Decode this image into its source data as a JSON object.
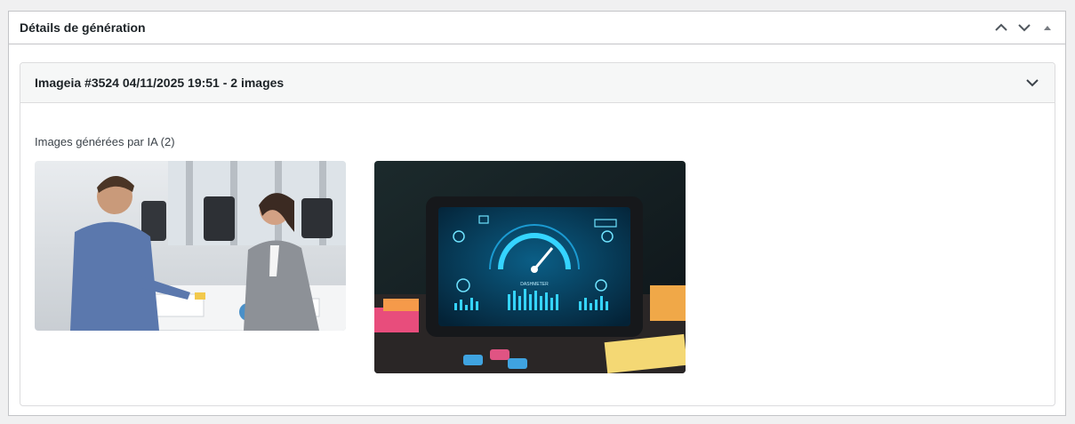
{
  "metabox": {
    "title": "Détails de génération"
  },
  "generation": {
    "header": "Imageia #3524 04/11/2025 19:51 - 2 images",
    "section_label": "Images générées par IA (2)",
    "images": [
      {
        "label": "image-1"
      },
      {
        "label": "image-2",
        "screen_text": "DASHMETER"
      }
    ]
  },
  "colors": {
    "border": "#c3c4c7",
    "header_bg": "#f6f7f7",
    "icon": "#50575e"
  },
  "icons": {
    "move_up": "chevron-up-icon",
    "move_down": "chevron-down-icon",
    "toggle": "triangle-up-icon",
    "expand": "chevron-down-icon"
  }
}
